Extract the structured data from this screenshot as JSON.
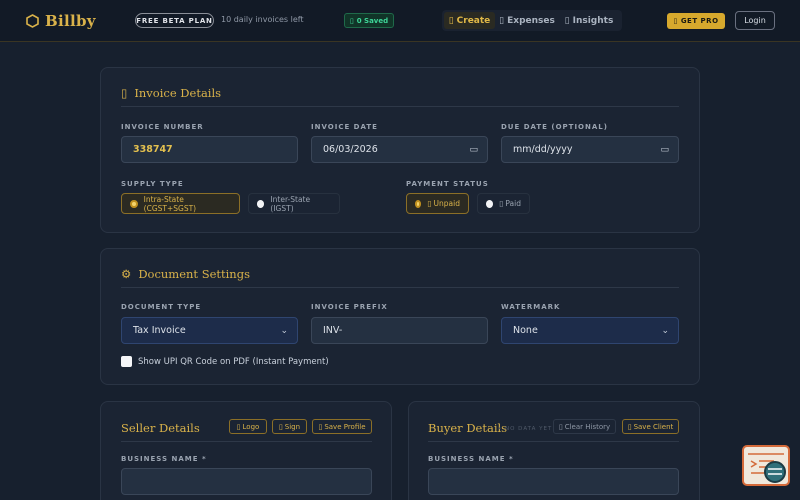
{
  "app": {
    "name": "Billby"
  },
  "navbar": {
    "beta_badge": "FREE BETA PLAN",
    "daily_limit": "10 daily invoices left",
    "saved_badge": "0 Saved",
    "tabs": [
      {
        "label": "Create",
        "icon": "edit-icon"
      },
      {
        "label": "Expenses",
        "icon": "wallet-icon"
      },
      {
        "label": "Insights",
        "icon": "chart-icon"
      }
    ],
    "active_tab": "Create",
    "get_pro": "GET PRO",
    "login": "Login"
  },
  "invoice_details": {
    "title": "Invoice Details",
    "invoice_number_label": "INVOICE NUMBER",
    "invoice_number": "338747",
    "invoice_date_label": "INVOICE DATE",
    "invoice_date": "06/03/2026",
    "due_date_label": "DUE DATE (OPTIONAL)",
    "due_date_placeholder": "mm/dd/yyyy",
    "supply_type_label": "SUPPLY TYPE",
    "supply_options": [
      "Intra-State (CGST+SGST)",
      "Inter-State (IGST)"
    ],
    "supply_selected": "Intra-State (CGST+SGST)",
    "payment_status_label": "PAYMENT STATUS",
    "payment_options": [
      "Unpaid",
      "Paid"
    ],
    "payment_selected": "Unpaid"
  },
  "document_settings": {
    "title": "Document Settings",
    "document_type_label": "DOCUMENT TYPE",
    "document_type": "Tax Invoice",
    "invoice_prefix_label": "INVOICE PREFIX",
    "invoice_prefix": "INV-",
    "watermark_label": "WATERMARK",
    "watermark": "None",
    "upi_checkbox_label": "Show UPI QR Code on PDF (Instant Payment)",
    "upi_checked": false
  },
  "seller": {
    "title": "Seller Details",
    "buttons": [
      "Logo",
      "Sign",
      "Save Profile"
    ],
    "business_name_label": "BUSINESS NAME *",
    "business_name": ""
  },
  "buyer": {
    "title": "Buyer Details",
    "no_data": "• NO DATA YET",
    "buttons": [
      "Clear History",
      "Save Client"
    ],
    "business_name_label": "BUSINESS NAME *",
    "business_name": ""
  },
  "colors": {
    "accent_gold": "#d9b24a",
    "saved_green": "#3ed598",
    "background": "#17202e",
    "card": "#1b2433"
  }
}
